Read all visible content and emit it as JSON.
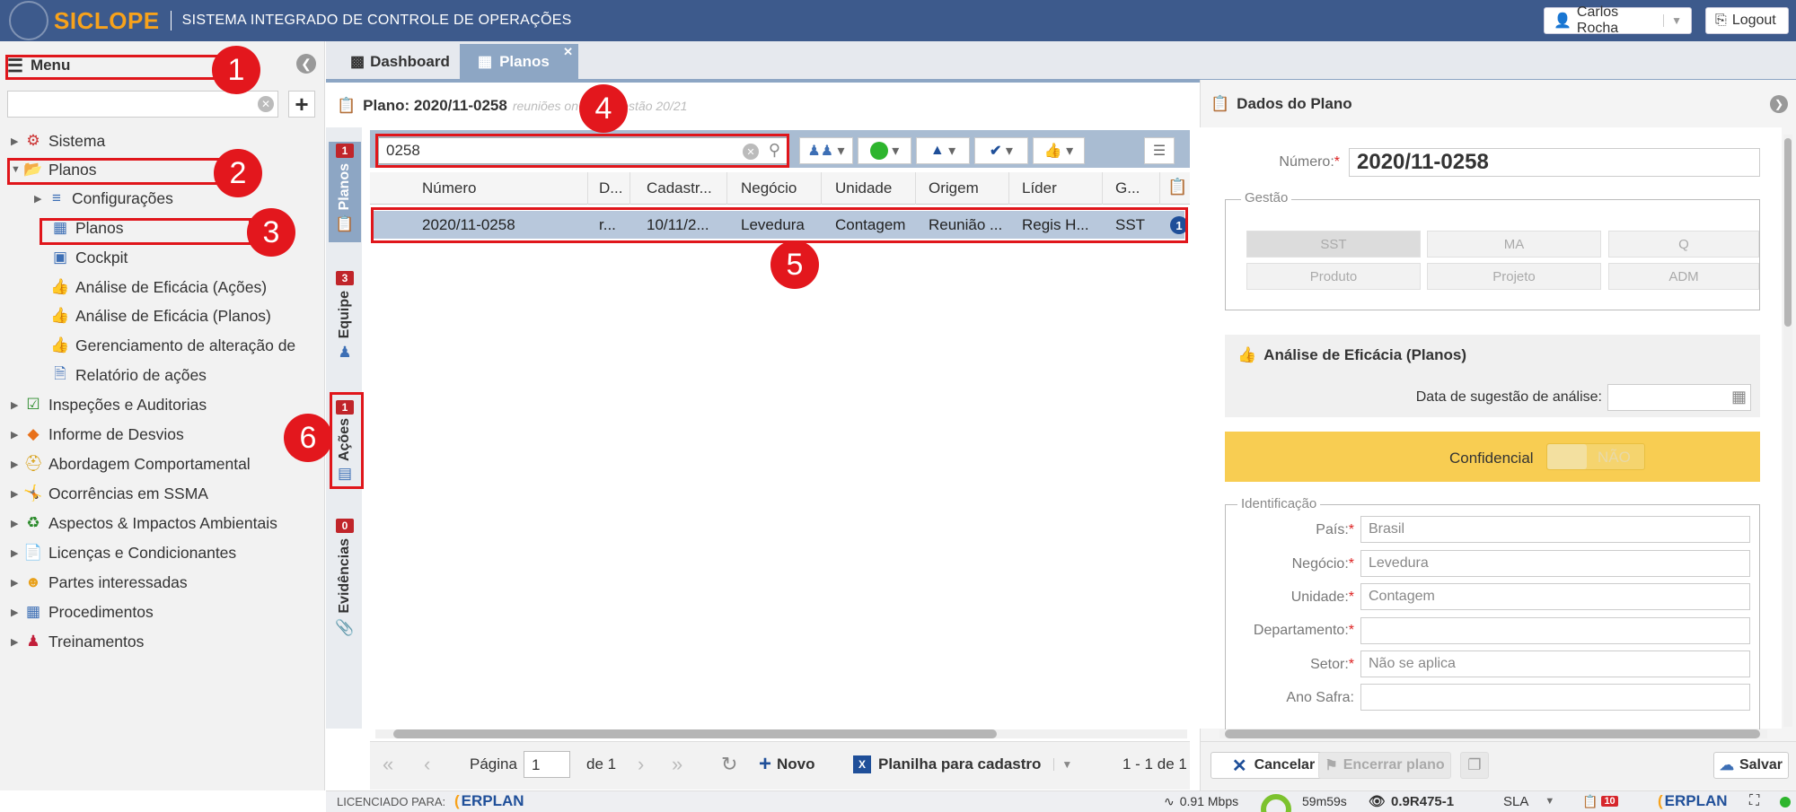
{
  "header": {
    "brand": "SICLOPE",
    "subtitle": "SISTEMA INTEGRADO DE CONTROLE DE OPERAÇÕES",
    "user": "Carlos Rocha",
    "logout": "Logout"
  },
  "menu": {
    "title": "Menu",
    "items": [
      {
        "label": "Sistema"
      },
      {
        "label": "Planos"
      },
      {
        "label": "Configurações"
      },
      {
        "label": "Planos"
      },
      {
        "label": "Cockpit"
      },
      {
        "label": "Análise de Eficácia (Ações)"
      },
      {
        "label": "Análise de Eficácia (Planos)"
      },
      {
        "label": "Gerenciamento de alteração de"
      },
      {
        "label": "Relatório de ações"
      },
      {
        "label": "Inspeções e Auditorias"
      },
      {
        "label": "Informe de Desvios"
      },
      {
        "label": "Abordagem Comportamental"
      },
      {
        "label": "Ocorrências em SSMA"
      },
      {
        "label": "Aspectos & Impactos Ambientais"
      },
      {
        "label": "Licenças e Condicionantes"
      },
      {
        "label": "Partes interessadas"
      },
      {
        "label": "Procedimentos"
      },
      {
        "label": "Treinamentos"
      }
    ]
  },
  "tabs": [
    {
      "label": "Dashboard"
    },
    {
      "label": "Planos"
    }
  ],
  "plan": {
    "title": "Plano: 2020/11-0258",
    "title_hint": "reuniões on ... PA gestão 20/21"
  },
  "vtabs": [
    {
      "label": "Planos",
      "count": "1"
    },
    {
      "label": "Equipe",
      "count": "3"
    },
    {
      "label": "Ações",
      "count": "1"
    },
    {
      "label": "Evidências",
      "count": "0"
    }
  ],
  "grid": {
    "search_value": "0258",
    "columns": [
      "Número",
      "D...",
      "Cadastr...",
      "Negócio",
      "Unidade",
      "Origem",
      "Líder",
      "G..."
    ],
    "rows": [
      {
        "numero": "2020/11-0258",
        "d": "r...",
        "cadastro": "10/11/2...",
        "negocio": "Levedura",
        "unidade": "Contagem",
        "origem": "Reunião ...",
        "lider": "Regis H...",
        "g": "SST",
        "badge": "1"
      }
    ]
  },
  "pager": {
    "page_label": "Página",
    "page": "1",
    "of": "de 1",
    "novo": "Novo",
    "planilha": "Planilha para cadastro",
    "range": "1 - 1 de 1"
  },
  "annotations": [
    "1",
    "2",
    "3",
    "4",
    "5",
    "6"
  ],
  "right": {
    "title": "Dados do Plano",
    "numero_label": "Número:",
    "numero_value": "2020/11-0258",
    "gestao_legend": "Gestão",
    "gestao_buttons": [
      "SST",
      "MA",
      "Q",
      "Produto",
      "Projeto",
      "ADM"
    ],
    "eficacia_title": "Análise de Eficácia (Planos)",
    "data_sugestao_label": "Data de sugestão de análise:",
    "confidencial_label": "Confidencial",
    "confidencial_value": "NÃO",
    "identificacao_legend": "Identificação",
    "fields": [
      {
        "label": "País:",
        "value": "Brasil",
        "required": true
      },
      {
        "label": "Negócio:",
        "value": "Levedura",
        "required": true
      },
      {
        "label": "Unidade:",
        "value": "Contagem",
        "required": true
      },
      {
        "label": "Departamento:",
        "value": "",
        "required": true
      },
      {
        "label": "Setor:",
        "value": "Não se aplica",
        "required": true
      },
      {
        "label": "Ano Safra:",
        "value": "",
        "required": false
      }
    ],
    "cancelar": "Cancelar",
    "encerrar": "Encerrar plano",
    "salvar": "Salvar"
  },
  "footer": {
    "licenciado": "LICENCIADO PARA:",
    "erplan": "ERPLAN",
    "speed": "0.91 Mbps",
    "timer": "59m59s",
    "version": "0.9R475-1",
    "sla": "SLA",
    "notif_count": "10"
  },
  "colors": {
    "topbar": "#3d5a8c",
    "brand_orange": "#f7a21b",
    "highlight_red": "#e0161b",
    "selected_row": "#b8c8dc",
    "confidencial_bg": "#f8cd52"
  }
}
